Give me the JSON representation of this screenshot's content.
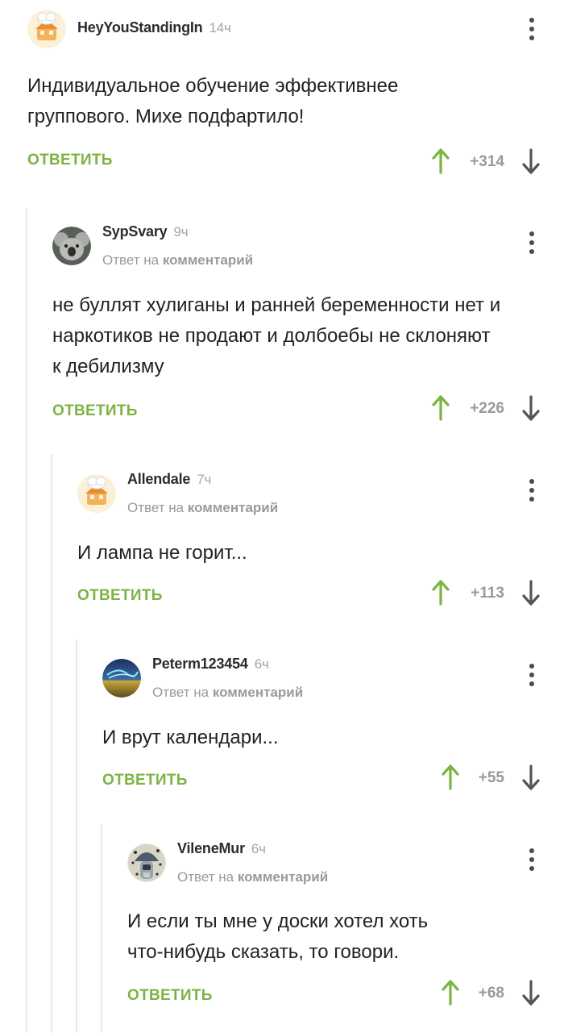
{
  "reply_label": "ОТВЕТИТЬ",
  "reply_prefix": "Ответ на",
  "reply_target": "комментарий",
  "colors": {
    "accent": "#7cb342",
    "muted": "#9a9a9a",
    "thread_line": "#e9e9e9"
  },
  "comments": [
    {
      "author": "HeyYouStandingIn",
      "time": "14ч",
      "text_lines": [
        "Индивидуальное обучение эффективнее",
        "группового. Михе подфартило!"
      ],
      "score": "+314",
      "avatar": "house-avatar"
    },
    {
      "author": "SypSvary",
      "time": "9ч",
      "text_lines": [
        "не буллят хулиганы и ранней беременности нет и",
        "наркотиков не продают и долбоебы не склоняют",
        "к дебилизму"
      ],
      "score": "+226",
      "avatar": "koala-avatar"
    },
    {
      "author": "Allendale",
      "time": "7ч",
      "text_lines": [
        "И лампа не горит..."
      ],
      "score": "+113",
      "avatar": "house-avatar"
    },
    {
      "author": "Peterm123454",
      "time": "6ч",
      "text_lines": [
        "И врут календари..."
      ],
      "score": "+55",
      "avatar": "landscape-avatar"
    },
    {
      "author": "VileneMur",
      "time": "6ч",
      "text_lines": [
        "И если ты мне у доски хотел хоть",
        "что-нибудь сказать, то говори."
      ],
      "score": "+68",
      "avatar": "astronaut-avatar"
    }
  ]
}
